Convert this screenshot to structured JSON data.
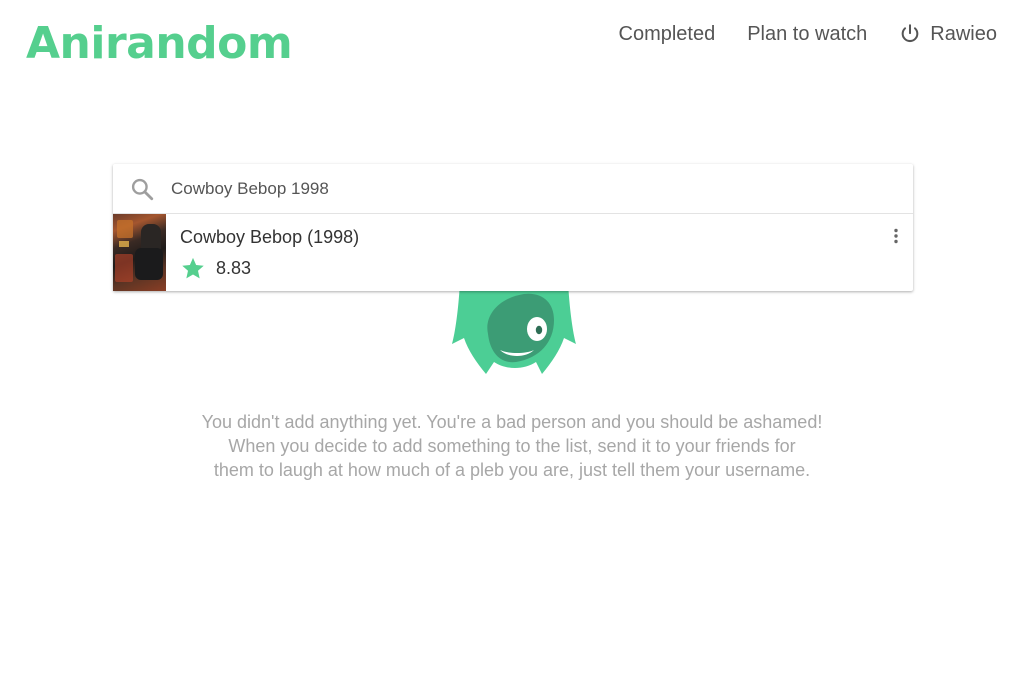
{
  "app": {
    "title": "Anirandom"
  },
  "nav": {
    "completed": "Completed",
    "plan_to_watch": "Plan to watch",
    "username": "Rawieo",
    "power_icon": "power-icon"
  },
  "search": {
    "value": "Cowboy Bebop 1998",
    "icon": "search-icon"
  },
  "results": [
    {
      "title": "Cowboy Bebop (1998)",
      "score": "8.83",
      "icon": "star-icon"
    }
  ],
  "empty_state": {
    "lines": [
      "You didn't add anything yet. You're a bad person and you should be ashamed!",
      "When you decide to add something to the list, send it to your friends for",
      "them to laugh at how much of a pleb you are, just tell them your username."
    ]
  },
  "colors": {
    "brand": "#55cf8e",
    "mascot_dark": "#3c9c75",
    "text_muted": "#a7a7a7"
  }
}
